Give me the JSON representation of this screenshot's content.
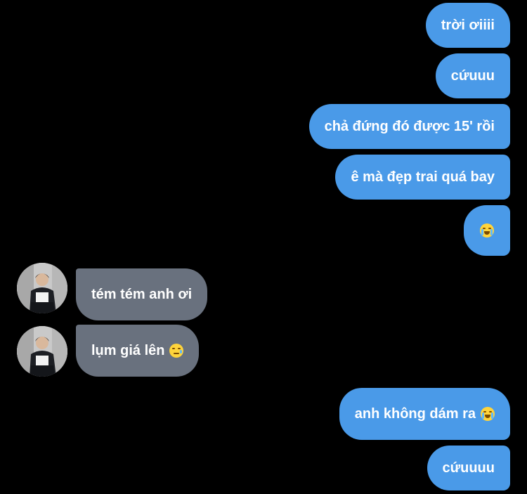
{
  "conversation": {
    "messages": [
      {
        "side": "out",
        "text": "trời ơiiii"
      },
      {
        "side": "out",
        "text": "cứuuu"
      },
      {
        "side": "out",
        "text": "chả đứng đó được 15' rồi"
      },
      {
        "side": "out",
        "text": "ê mà đẹp trai quá bay"
      },
      {
        "side": "out",
        "emoji": "loudly-crying-face"
      },
      {
        "side": "in",
        "text": "tém tém anh ơi"
      },
      {
        "side": "in",
        "text": "lụm giá lên",
        "emoji": "face-holding-back-tears"
      },
      {
        "side": "out",
        "text": "anh không dám ra",
        "emoji": "loudly-crying-face"
      },
      {
        "side": "out",
        "text": "cứuuuu"
      }
    ]
  },
  "colors": {
    "background": "#000000",
    "outgoing_bubble": "#4a9ae8",
    "incoming_bubble": "#69717e",
    "text": "#ffffff"
  }
}
